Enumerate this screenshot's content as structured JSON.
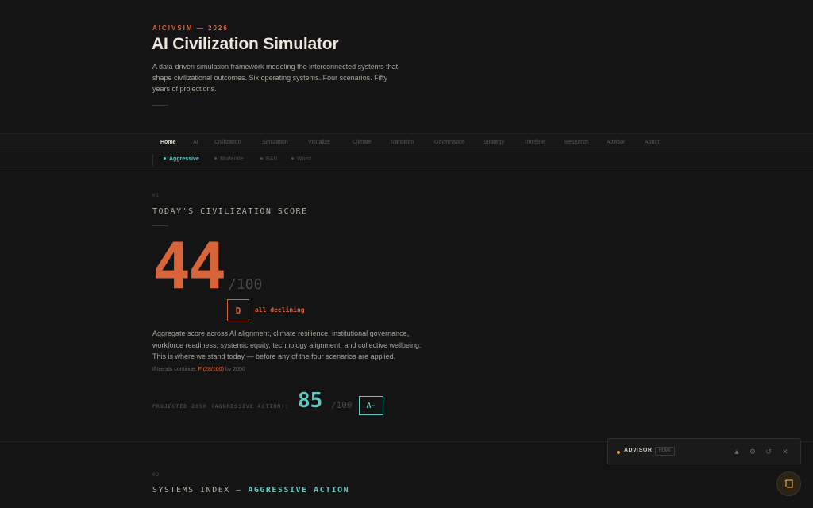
{
  "hero": {
    "eyebrow": "AICIVSIM — 2026",
    "title": "AI Civilization Simulator",
    "description": "A data-driven simulation framework modeling the interconnected systems that shape civilizational outcomes. Six operating systems. Four scenarios. Fifty years of projections."
  },
  "nav": {
    "items": [
      {
        "label": "Home",
        "active": true
      },
      {
        "label": "AI"
      },
      {
        "label": "Civilization"
      },
      {
        "label": "Simulation"
      },
      {
        "label": "Visualize"
      },
      {
        "label": "Climate"
      },
      {
        "label": "Transition"
      },
      {
        "label": "Governance"
      },
      {
        "label": "Strategy"
      },
      {
        "label": "Timeline"
      },
      {
        "label": "Research"
      },
      {
        "label": "Advisor"
      },
      {
        "label": "About"
      }
    ]
  },
  "scenarios": [
    {
      "label": "Aggressive",
      "active": true
    },
    {
      "label": "Moderate"
    },
    {
      "label": "BAU"
    },
    {
      "label": "Worst"
    }
  ],
  "score_section": {
    "number": "01",
    "title": "TODAY'S CIVILIZATION SCORE",
    "score": "44",
    "out_of": "/100",
    "grade": "D",
    "trend": "all declining",
    "description": "Aggregate score across AI alignment, climate resilience, institutional governance, workforce readiness, systemic equity, technology alignment, and collective wellbeing. This is where we stand today — before any of the four scenarios are applied.",
    "continue_prefix": "If trends continue:",
    "continue_value": "F (28/100)",
    "continue_suffix": "by 2050",
    "projected_label": "PROJECTED 2050 (AGGRESSIVE ACTION):",
    "projected_score": "85",
    "projected_out_of": "/100",
    "projected_grade": "A-"
  },
  "systems_section": {
    "number": "02",
    "title_prefix": "SYSTEMS INDEX —",
    "title_accent": "AGGRESSIVE ACTION"
  },
  "advisor": {
    "label": "ADVISOR",
    "badge": "HOME",
    "icons": [
      "triangle-icon",
      "gear-icon",
      "refresh-icon",
      "close-icon"
    ]
  },
  "colors": {
    "accent_orange": "#d8643a",
    "accent_teal": "#5ec9c1",
    "background": "#141414"
  }
}
